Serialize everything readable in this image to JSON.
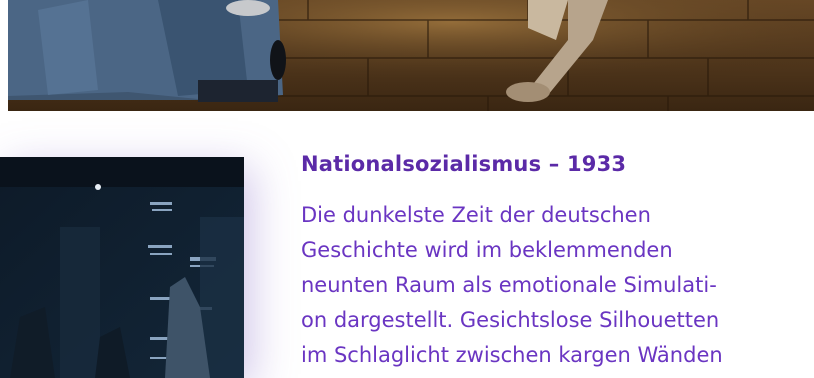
{
  "section": {
    "heading": "Nationalsozialismus – 1933",
    "body": "Die dunkelste Zeit der deutschen\nGeschichte wird im beklemmenden\nneunten Raum als emotionale Simulati-\non dargestellt. Gesichtslose Silhouetten\nim Schlaglicht zwischen kargen Wänden"
  },
  "images": {
    "top_photo": "exhibition-photo-stone-wall",
    "side_photo": "exhibition-photo-dark-room"
  },
  "colors": {
    "heading": "#5b2aa7",
    "body": "#6a35c2",
    "glow": "#7c5cc4"
  }
}
